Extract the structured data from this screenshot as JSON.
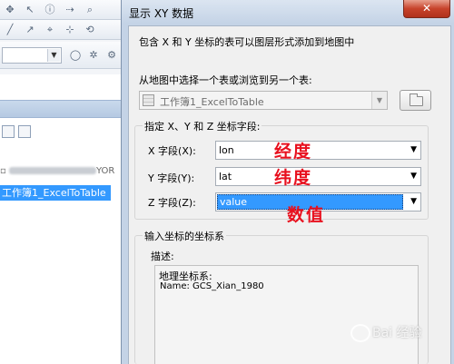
{
  "dialog": {
    "title": "显示 XY 数据",
    "close_label": "✕",
    "intro_text": "包含 X 和 Y 坐标的表可以图层形式添加到地图中",
    "choose_table_label": "从地图中选择一个表或浏览到另一个表:",
    "table_value": "工作簿1_ExcelToTable",
    "fields_group_title": "指定 X、Y 和 Z 坐标字段:",
    "fields": [
      {
        "label": "X 字段(X):",
        "value": "lon",
        "note": "经度"
      },
      {
        "label": "Y 字段(Y):",
        "value": "lat",
        "note": "纬度"
      },
      {
        "label": "Z 字段(Z):",
        "value": "value",
        "note": "数值"
      }
    ],
    "crs_group_title": "输入坐标的坐标系",
    "description_label": "描述:",
    "crs_description": {
      "type": "地理坐标系:",
      "name": "Name: GCS_Xian_1980"
    }
  },
  "background": {
    "path_suffix": "YOR",
    "selected_layer": "工作簿1_ExcelToTable"
  },
  "watermark": "Bai 经验",
  "colors": {
    "selection": "#3399ff",
    "annotation": "#e8101e"
  }
}
